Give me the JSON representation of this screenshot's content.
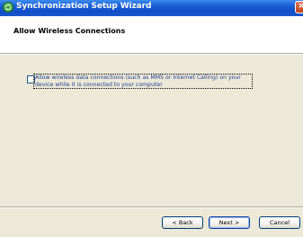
{
  "window": {
    "title": "Synchronization Setup Wizard",
    "close_glyph": "×"
  },
  "header": {
    "title": "Allow Wireless Connections"
  },
  "option": {
    "checked": false,
    "label": "Allow wireless data connections (such as MMS or Internet Calling) on your device while it is connected to your computer"
  },
  "buttons": {
    "back": "< Back",
    "next": "Next >",
    "cancel": "Cancel"
  },
  "colors": {
    "titlebar": "#0f4fc9",
    "dialog_bg": "#ece9d8",
    "label_text": "#1f3e8f"
  }
}
